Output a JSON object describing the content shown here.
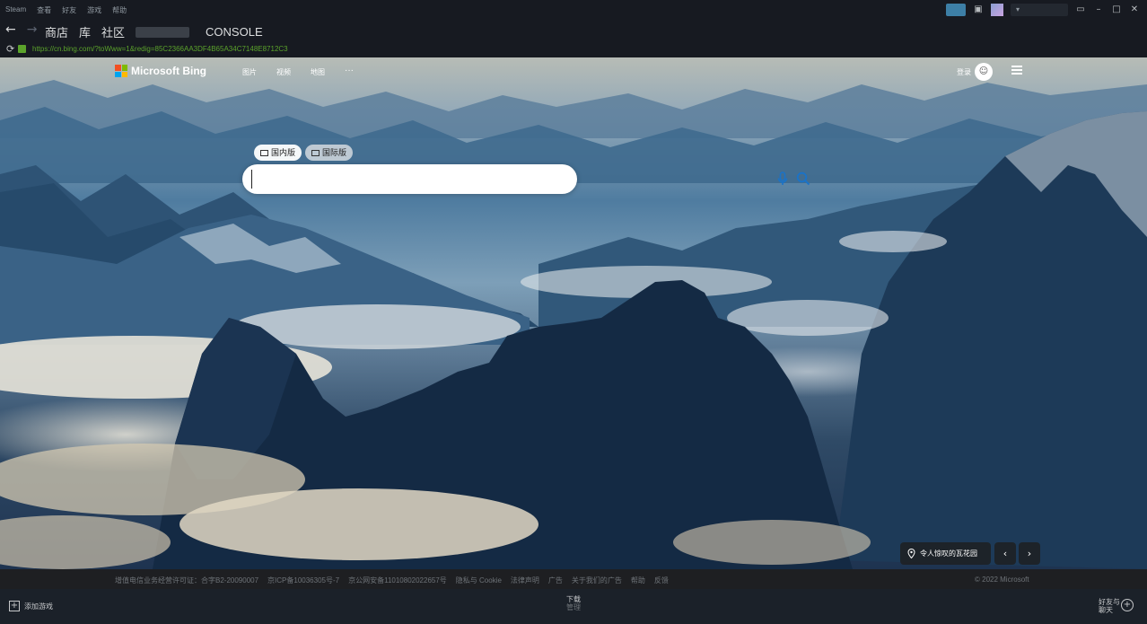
{
  "steam": {
    "menu": [
      "Steam",
      "查看",
      "好友",
      "游戏",
      "帮助"
    ],
    "nav_links": [
      "商店",
      "库",
      "社区"
    ],
    "console_label": "CONSOLE",
    "url": "https://cn.bing.com/?toWww=1&redig=85C2366AA3DF4B65A34C7148E8712C3",
    "add_game": "添加游戏",
    "downloads_label": "下载",
    "downloads_sub": "管理",
    "friends_line1": "好友与",
    "friends_line2": "聊天",
    "icons": {
      "back": "back-arrow-icon",
      "forward": "forward-arrow-icon",
      "reload": "reload-icon",
      "lock": "lock-icon"
    }
  },
  "bing": {
    "logo_text": "Microsoft Bing",
    "nav": [
      "图片",
      "视频",
      "地图"
    ],
    "more": "···",
    "signin": "登录",
    "tabs": [
      "国内版",
      "国际版"
    ],
    "search": {
      "placeholder": "",
      "value": ""
    },
    "location": "令人惊叹的瓦花园",
    "prev": "‹",
    "next": "›",
    "footer_links": [
      "增值电信业务经营许可证：合字B2-20090007",
      "京ICP备10036305号-7",
      "京公网安备11010802022657号",
      "隐私与 Cookie",
      "法律声明",
      "广告",
      "关于我们的广告",
      "帮助",
      "反馈"
    ],
    "copyright": "© 2022 Microsoft"
  },
  "colors": {
    "steam_bg": "#171a21",
    "url_green": "#5ba32b",
    "accent_blue": "#3d7fa6"
  }
}
